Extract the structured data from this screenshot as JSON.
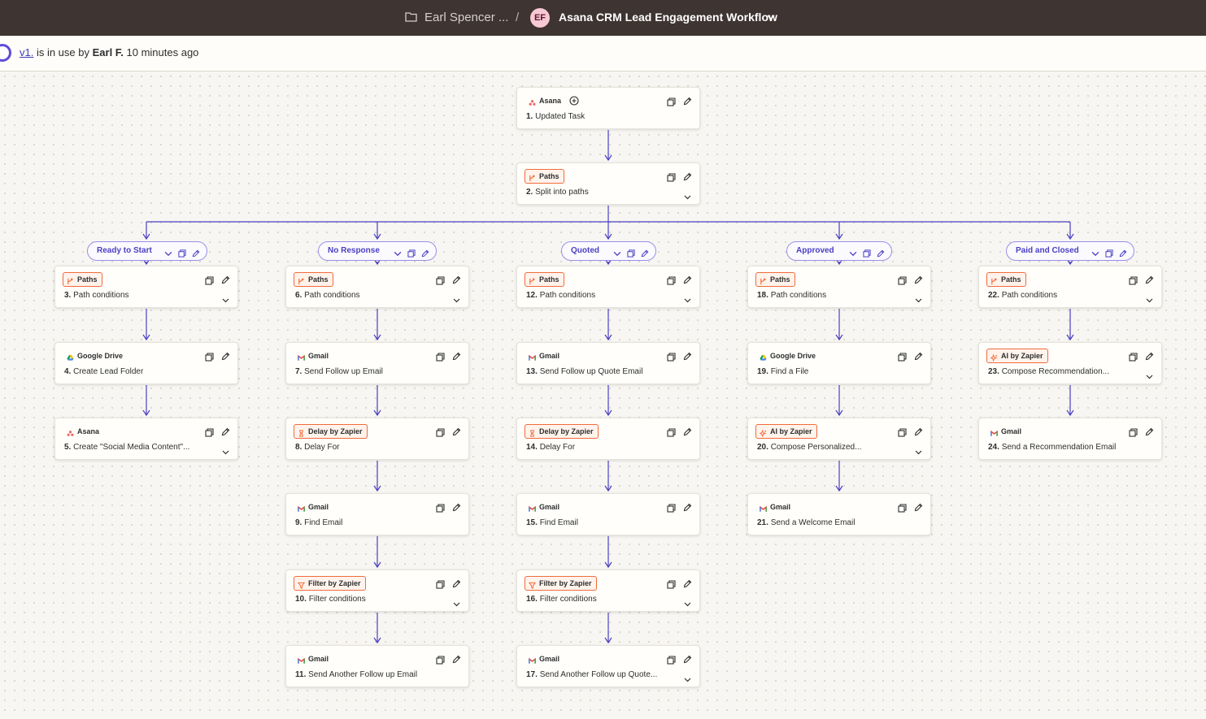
{
  "header": {
    "folder_name": "Earl Spencer ...",
    "separator": "/",
    "avatar_initials": "EF",
    "zap_title": "Asana CRM Lead Engagement Workflow"
  },
  "status": {
    "version": "v1.",
    "text_in_use": " is in use by ",
    "user": "Earl F.",
    "time": " 10 minutes ago"
  },
  "colors": {
    "topbar": "#3e3432",
    "accent": "#5f4bd8",
    "path_label": "#4a3fc2",
    "chip_orange": "#f26b3a",
    "canvas": "#f7f6f2"
  },
  "branches": [
    {
      "label": "Ready to Start"
    },
    {
      "label": "No Response"
    },
    {
      "label": "Quoted"
    },
    {
      "label": "Approved"
    },
    {
      "label": "Paid and Closed"
    }
  ],
  "steps": [
    {
      "app": "Asana",
      "icon": "asana-icon",
      "num": "1.",
      "title": "Updated Task"
    },
    {
      "app": "Paths",
      "icon": "paths-icon",
      "num": "2.",
      "title": "Split into paths"
    },
    {
      "app": "Paths",
      "icon": "paths-icon",
      "num": "3.",
      "title": "Path conditions"
    },
    {
      "app": "Google Drive",
      "icon": "google-drive-icon",
      "num": "4.",
      "title": "Create Lead Folder"
    },
    {
      "app": "Asana",
      "icon": "asana-icon",
      "num": "5.",
      "title": "Create \"Social Media Content\"..."
    },
    {
      "app": "Paths",
      "icon": "paths-icon",
      "num": "6.",
      "title": "Path conditions"
    },
    {
      "app": "Gmail",
      "icon": "gmail-icon",
      "num": "7.",
      "title": "Send Follow up Email"
    },
    {
      "app": "Delay by Zapier",
      "icon": "delay-icon",
      "num": "8.",
      "title": "Delay For"
    },
    {
      "app": "Gmail",
      "icon": "gmail-icon",
      "num": "9.",
      "title": "Find Email"
    },
    {
      "app": "Filter by Zapier",
      "icon": "filter-icon",
      "num": "10.",
      "title": "Filter conditions"
    },
    {
      "app": "Gmail",
      "icon": "gmail-icon",
      "num": "11.",
      "title": "Send Another Follow up Email"
    },
    {
      "app": "Paths",
      "icon": "paths-icon",
      "num": "12.",
      "title": "Path conditions"
    },
    {
      "app": "Gmail",
      "icon": "gmail-icon",
      "num": "13.",
      "title": "Send Follow up Quote Email"
    },
    {
      "app": "Delay by Zapier",
      "icon": "delay-icon",
      "num": "14.",
      "title": "Delay For"
    },
    {
      "app": "Gmail",
      "icon": "gmail-icon",
      "num": "15.",
      "title": "Find Email"
    },
    {
      "app": "Filter by Zapier",
      "icon": "filter-icon",
      "num": "16.",
      "title": "Filter conditions"
    },
    {
      "app": "Gmail",
      "icon": "gmail-icon",
      "num": "17.",
      "title": "Send Another Follow up Quote..."
    },
    {
      "app": "Paths",
      "icon": "paths-icon",
      "num": "18.",
      "title": "Path conditions"
    },
    {
      "app": "Google Drive",
      "icon": "google-drive-icon",
      "num": "19.",
      "title": "Find a File"
    },
    {
      "app": "AI by Zapier",
      "icon": "ai-icon",
      "num": "20.",
      "title": "Compose Personalized..."
    },
    {
      "app": "Gmail",
      "icon": "gmail-icon",
      "num": "21.",
      "title": "Send a Welcome Email"
    },
    {
      "app": "Paths",
      "icon": "paths-icon",
      "num": "22.",
      "title": "Path conditions"
    },
    {
      "app": "AI by Zapier",
      "icon": "ai-icon",
      "num": "23.",
      "title": "Compose Recommendation..."
    },
    {
      "app": "Gmail",
      "icon": "gmail-icon",
      "num": "24.",
      "title": "Send a Recommendation Email"
    }
  ]
}
